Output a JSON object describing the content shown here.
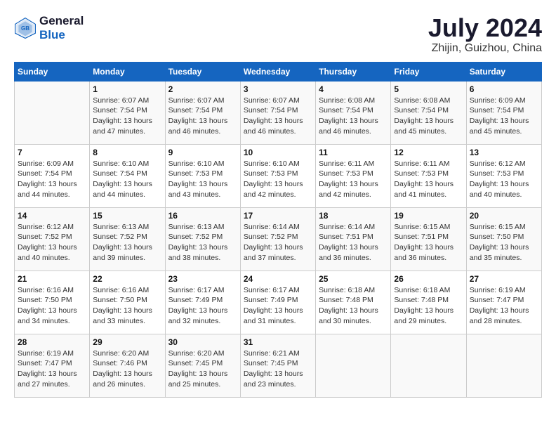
{
  "header": {
    "logo_line1": "General",
    "logo_line2": "Blue",
    "month_year": "July 2024",
    "location": "Zhijin, Guizhou, China"
  },
  "days_of_week": [
    "Sunday",
    "Monday",
    "Tuesday",
    "Wednesday",
    "Thursday",
    "Friday",
    "Saturday"
  ],
  "weeks": [
    [
      {
        "day": "",
        "info": ""
      },
      {
        "day": "1",
        "info": "Sunrise: 6:07 AM\nSunset: 7:54 PM\nDaylight: 13 hours\nand 47 minutes."
      },
      {
        "day": "2",
        "info": "Sunrise: 6:07 AM\nSunset: 7:54 PM\nDaylight: 13 hours\nand 46 minutes."
      },
      {
        "day": "3",
        "info": "Sunrise: 6:07 AM\nSunset: 7:54 PM\nDaylight: 13 hours\nand 46 minutes."
      },
      {
        "day": "4",
        "info": "Sunrise: 6:08 AM\nSunset: 7:54 PM\nDaylight: 13 hours\nand 46 minutes."
      },
      {
        "day": "5",
        "info": "Sunrise: 6:08 AM\nSunset: 7:54 PM\nDaylight: 13 hours\nand 45 minutes."
      },
      {
        "day": "6",
        "info": "Sunrise: 6:09 AM\nSunset: 7:54 PM\nDaylight: 13 hours\nand 45 minutes."
      }
    ],
    [
      {
        "day": "7",
        "info": "Sunrise: 6:09 AM\nSunset: 7:54 PM\nDaylight: 13 hours\nand 44 minutes."
      },
      {
        "day": "8",
        "info": "Sunrise: 6:10 AM\nSunset: 7:54 PM\nDaylight: 13 hours\nand 44 minutes."
      },
      {
        "day": "9",
        "info": "Sunrise: 6:10 AM\nSunset: 7:53 PM\nDaylight: 13 hours\nand 43 minutes."
      },
      {
        "day": "10",
        "info": "Sunrise: 6:10 AM\nSunset: 7:53 PM\nDaylight: 13 hours\nand 42 minutes."
      },
      {
        "day": "11",
        "info": "Sunrise: 6:11 AM\nSunset: 7:53 PM\nDaylight: 13 hours\nand 42 minutes."
      },
      {
        "day": "12",
        "info": "Sunrise: 6:11 AM\nSunset: 7:53 PM\nDaylight: 13 hours\nand 41 minutes."
      },
      {
        "day": "13",
        "info": "Sunrise: 6:12 AM\nSunset: 7:53 PM\nDaylight: 13 hours\nand 40 minutes."
      }
    ],
    [
      {
        "day": "14",
        "info": "Sunrise: 6:12 AM\nSunset: 7:52 PM\nDaylight: 13 hours\nand 40 minutes."
      },
      {
        "day": "15",
        "info": "Sunrise: 6:13 AM\nSunset: 7:52 PM\nDaylight: 13 hours\nand 39 minutes."
      },
      {
        "day": "16",
        "info": "Sunrise: 6:13 AM\nSunset: 7:52 PM\nDaylight: 13 hours\nand 38 minutes."
      },
      {
        "day": "17",
        "info": "Sunrise: 6:14 AM\nSunset: 7:52 PM\nDaylight: 13 hours\nand 37 minutes."
      },
      {
        "day": "18",
        "info": "Sunrise: 6:14 AM\nSunset: 7:51 PM\nDaylight: 13 hours\nand 36 minutes."
      },
      {
        "day": "19",
        "info": "Sunrise: 6:15 AM\nSunset: 7:51 PM\nDaylight: 13 hours\nand 36 minutes."
      },
      {
        "day": "20",
        "info": "Sunrise: 6:15 AM\nSunset: 7:50 PM\nDaylight: 13 hours\nand 35 minutes."
      }
    ],
    [
      {
        "day": "21",
        "info": "Sunrise: 6:16 AM\nSunset: 7:50 PM\nDaylight: 13 hours\nand 34 minutes."
      },
      {
        "day": "22",
        "info": "Sunrise: 6:16 AM\nSunset: 7:50 PM\nDaylight: 13 hours\nand 33 minutes."
      },
      {
        "day": "23",
        "info": "Sunrise: 6:17 AM\nSunset: 7:49 PM\nDaylight: 13 hours\nand 32 minutes."
      },
      {
        "day": "24",
        "info": "Sunrise: 6:17 AM\nSunset: 7:49 PM\nDaylight: 13 hours\nand 31 minutes."
      },
      {
        "day": "25",
        "info": "Sunrise: 6:18 AM\nSunset: 7:48 PM\nDaylight: 13 hours\nand 30 minutes."
      },
      {
        "day": "26",
        "info": "Sunrise: 6:18 AM\nSunset: 7:48 PM\nDaylight: 13 hours\nand 29 minutes."
      },
      {
        "day": "27",
        "info": "Sunrise: 6:19 AM\nSunset: 7:47 PM\nDaylight: 13 hours\nand 28 minutes."
      }
    ],
    [
      {
        "day": "28",
        "info": "Sunrise: 6:19 AM\nSunset: 7:47 PM\nDaylight: 13 hours\nand 27 minutes."
      },
      {
        "day": "29",
        "info": "Sunrise: 6:20 AM\nSunset: 7:46 PM\nDaylight: 13 hours\nand 26 minutes."
      },
      {
        "day": "30",
        "info": "Sunrise: 6:20 AM\nSunset: 7:45 PM\nDaylight: 13 hours\nand 25 minutes."
      },
      {
        "day": "31",
        "info": "Sunrise: 6:21 AM\nSunset: 7:45 PM\nDaylight: 13 hours\nand 23 minutes."
      },
      {
        "day": "",
        "info": ""
      },
      {
        "day": "",
        "info": ""
      },
      {
        "day": "",
        "info": ""
      }
    ]
  ]
}
